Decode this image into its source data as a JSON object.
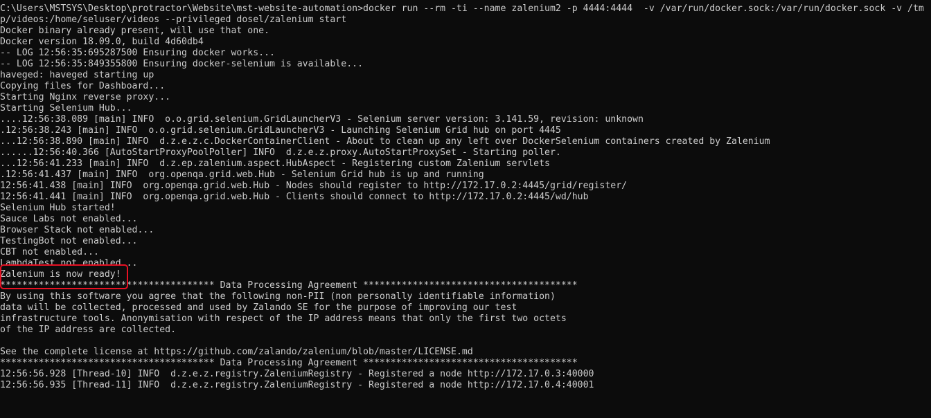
{
  "terminal": {
    "lines": [
      "C:\\Users\\MSTSYS\\Desktop\\protractor\\Website\\mst-website-automation>docker run --rm -ti --name zalenium2 -p 4444:4444  -v /var/run/docker.sock:/var/run/docker.sock -v /tm",
      "p/videos:/home/seluser/videos --privileged dosel/zalenium start",
      "Docker binary already present, will use that one.",
      "Docker version 18.09.0, build 4d60db4",
      "-- LOG 12:56:35:695287500 Ensuring docker works...",
      "-- LOG 12:56:35:849355800 Ensuring docker-selenium is available...",
      "haveged: haveged starting up",
      "Copying files for Dashboard...",
      "Starting Nginx reverse proxy...",
      "Starting Selenium Hub...",
      "....12:56:38.089 [main] INFO  o.o.grid.selenium.GridLauncherV3 - Selenium server version: 3.141.59, revision: unknown",
      ".12:56:38.243 [main] INFO  o.o.grid.selenium.GridLauncherV3 - Launching Selenium Grid hub on port 4445",
      "...12:56:38.890 [main] INFO  d.z.e.z.c.DockerContainerClient - About to clean up any left over DockerSelenium containers created by Zalenium",
      "......12:56:40.366 [AutoStartProxyPoolPoller] INFO  d.z.e.z.proxy.AutoStartProxySet - Starting poller.",
      "...12:56:41.233 [main] INFO  d.z.ep.zalenium.aspect.HubAspect - Registering custom Zalenium servlets",
      ".12:56:41.437 [main] INFO  org.openqa.grid.web.Hub - Selenium Grid hub is up and running",
      "12:56:41.438 [main] INFO  org.openqa.grid.web.Hub - Nodes should register to http://172.17.0.2:4445/grid/register/",
      "12:56:41.441 [main] INFO  org.openqa.grid.web.Hub - Clients should connect to http://172.17.0.2:4445/wd/hub",
      "Selenium Hub started!",
      "Sauce Labs not enabled...",
      "Browser Stack not enabled...",
      "TestingBot not enabled...",
      "CBT not enabled...",
      "LambdaTest not enabled...",
      "Zalenium is now ready!",
      "*************************************** Data Processing Agreement ***************************************",
      "By using this software you agree that the following non-PII (non personally identifiable information)",
      "data will be collected, processed and used by Zalando SE for the purpose of improving our test",
      "infrastructure tools. Anonymisation with respect of the IP address means that only the first two octets",
      "of the IP address are collected.",
      "",
      "See the complete license at https://github.com/zalando/zalenium/blob/master/LICENSE.md",
      "*************************************** Data Processing Agreement ***************************************",
      "12:56:56.928 [Thread-10] INFO  d.z.e.z.registry.ZaleniumRegistry - Registered a node http://172.17.0.3:40000",
      "12:56:56.935 [Thread-11] INFO  d.z.e.z.registry.ZaleniumRegistry - Registered a node http://172.17.0.4:40001"
    ]
  },
  "colors": {
    "background": "#0c0c0c",
    "text": "#cccccc",
    "highlight": "#e81123"
  }
}
